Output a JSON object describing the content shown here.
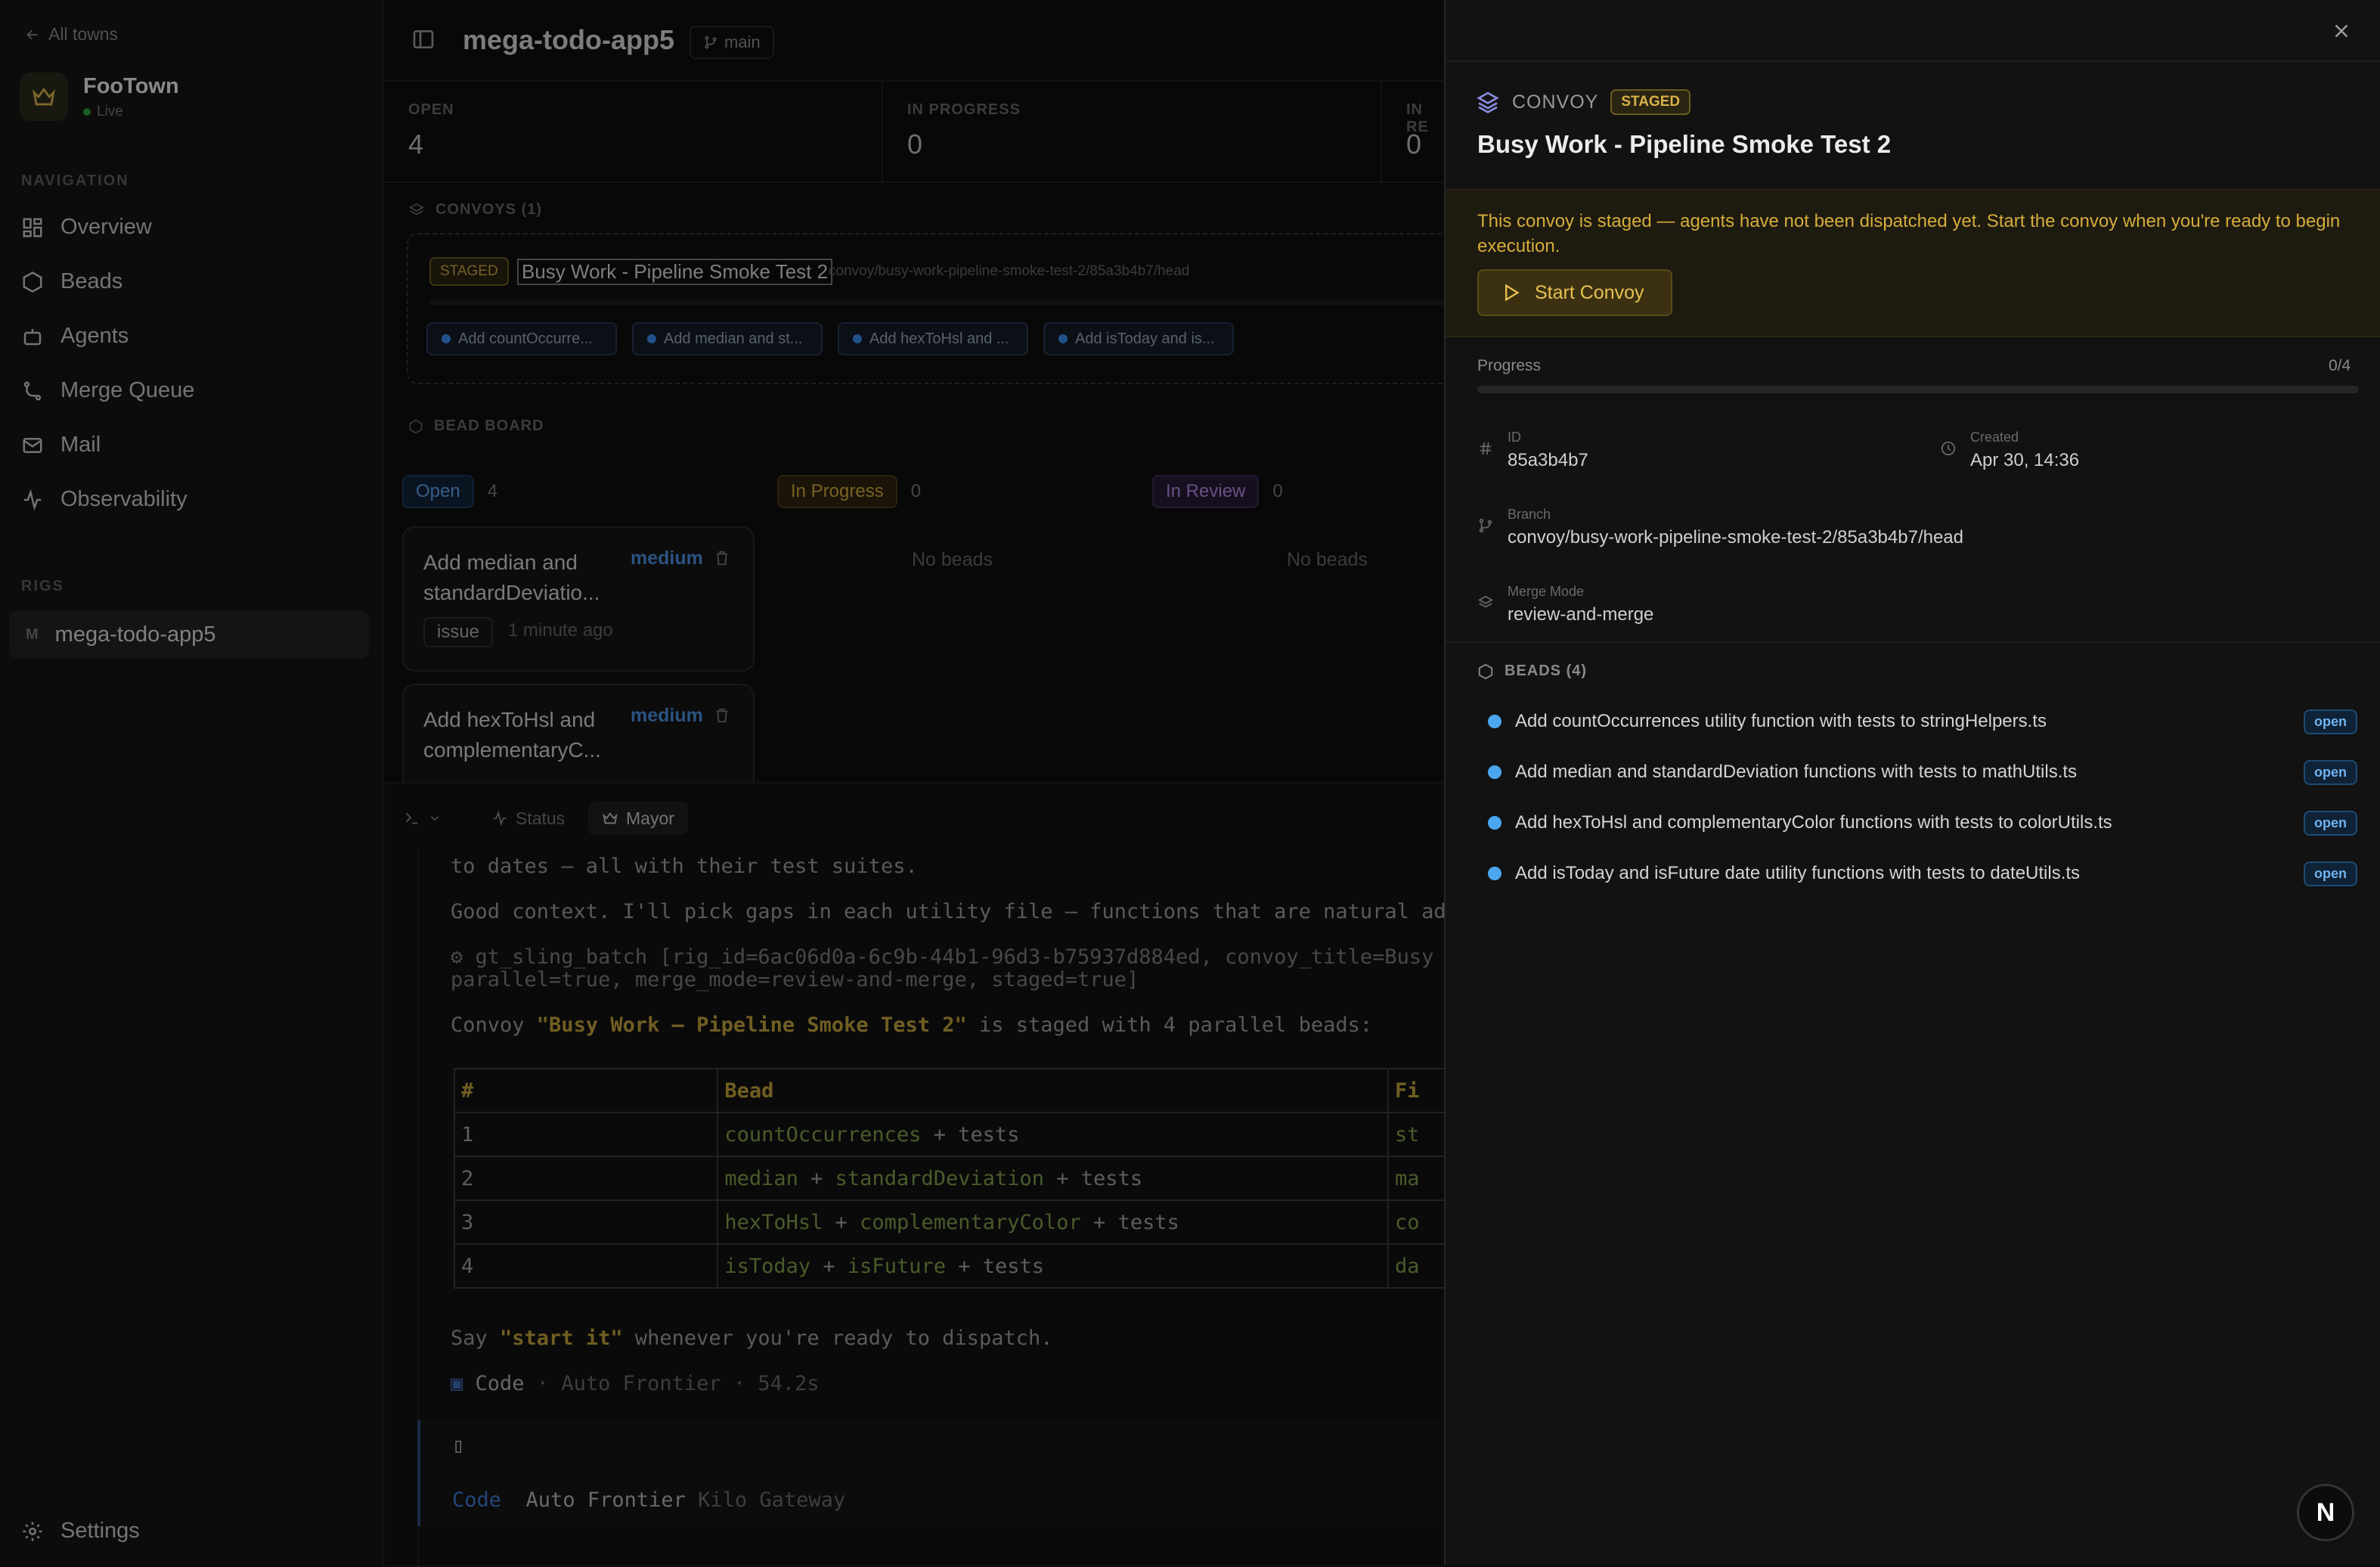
{
  "sidebar": {
    "back_label": "All towns",
    "town_name": "FooTown",
    "town_status": "Live",
    "nav_heading": "NAVIGATION",
    "nav_items": [
      {
        "label": "Overview",
        "icon": "grid-icon"
      },
      {
        "label": "Beads",
        "icon": "hexagon-icon"
      },
      {
        "label": "Agents",
        "icon": "bot-icon"
      },
      {
        "label": "Merge Queue",
        "icon": "git-merge-icon"
      },
      {
        "label": "Mail",
        "icon": "mail-icon"
      },
      {
        "label": "Observability",
        "icon": "activity-icon"
      }
    ],
    "rigs_heading": "RIGS",
    "rig": {
      "letter": "M",
      "label": "mega-todo-app5"
    },
    "settings_label": "Settings"
  },
  "main": {
    "title": "mega-todo-app5",
    "branch": "main",
    "stats": [
      {
        "label": "OPEN",
        "value": "4"
      },
      {
        "label": "IN PROGRESS",
        "value": "0"
      },
      {
        "label": "IN RE",
        "value": "0"
      }
    ],
    "convoys_heading": "CONVOYS (1)",
    "convoy": {
      "status": "STAGED",
      "title": "Busy Work - Pipeline Smoke Test 2",
      "branch": "convoy/busy-work-pipeline-smoke-test-2/85a3b4b7/head",
      "chips": [
        "Add countOccurre...",
        "Add median and st...",
        "Add hexToHsl and ...",
        "Add isToday and is..."
      ]
    },
    "bead_board_heading": "BEAD BOARD",
    "columns": [
      {
        "label": "Open",
        "count": "4"
      },
      {
        "label": "In Progress",
        "count": "0",
        "empty": "No beads"
      },
      {
        "label": "In Review",
        "count": "0",
        "empty": "No beads"
      }
    ],
    "bead_cards": [
      {
        "title": "Add median and standardDeviatio...",
        "priority": "medium",
        "tag": "issue",
        "time": "1 minute ago"
      },
      {
        "title": "Add hexToHsl and complementaryC...",
        "priority": "medium"
      }
    ]
  },
  "terminal": {
    "tabs": [
      {
        "label": "Status"
      },
      {
        "label": "Mayor"
      }
    ],
    "lines": {
      "l1": "to dates — all with their test suites.",
      "l2": "Good context. I'll pick gaps in each utility file — functions that are natural addit",
      "l3": "⚙ gt_sling_batch [rig_id=6ac06d0a-6c9b-44b1-96d3-b75937d884ed, convoy_title=Busy Wor",
      "l4": "parallel=true, merge_mode=review-and-merge, staged=true]",
      "l5_pre": "Convoy ",
      "l5_q": "\"Busy Work — Pipeline Smoke Test 2\"",
      "l5_post": " is staged with 4 parallel beads:",
      "say_pre": "Say ",
      "say_q": "\"start it\"",
      "say_post": " whenever you're ready to dispatch.",
      "code_meta_a": "Code",
      "code_meta_b": " · Auto Frontier · 54.2s",
      "input_cursor": "▯",
      "footer_a": "Code",
      "footer_b": "Auto Frontier",
      "footer_c": "Kilo Gateway"
    },
    "table": {
      "headers": [
        "#",
        "Bead",
        "Fi"
      ],
      "rows": [
        {
          "n": "1",
          "a": "countOccurrences",
          "b": "",
          "c": "st"
        },
        {
          "n": "2",
          "a": "median",
          "b": "standardDeviation",
          "c": "ma"
        },
        {
          "n": "3",
          "a": "hexToHsl",
          "b": "complementaryColor",
          "c": "co"
        },
        {
          "n": "4",
          "a": "isToday",
          "b": "isFuture",
          "c": "da"
        }
      ],
      "plus": " + ",
      "tests": "tests"
    }
  },
  "panel": {
    "kind": "CONVOY",
    "status": "STAGED",
    "title": "Busy Work - Pipeline Smoke Test 2",
    "banner": "This convoy is staged — agents have not been dispatched yet. Start the convoy when you're ready to begin execution.",
    "start_label": "Start Convoy",
    "progress_label": "Progress",
    "progress_count": "0/4",
    "progress_fraction": 0,
    "meta": {
      "id_label": "ID",
      "id_value": "85a3b4b7",
      "created_label": "Created",
      "created_value": "Apr 30, 14:36",
      "branch_label": "Branch",
      "branch_value": "convoy/busy-work-pipeline-smoke-test-2/85a3b4b7/head",
      "merge_label": "Merge Mode",
      "merge_value": "review-and-merge"
    },
    "beads_heading": "BEADS (4)",
    "beads": [
      {
        "label": "Add countOccurrences utility function with tests to stringHelpers.ts",
        "status": "open"
      },
      {
        "label": "Add median and standardDeviation functions with tests to mathUtils.ts",
        "status": "open"
      },
      {
        "label": "Add hexToHsl and complementaryColor functions with tests to colorUtils.ts",
        "status": "open"
      },
      {
        "label": "Add isToday and isFuture date utility functions with tests to dateUtils.ts",
        "status": "open"
      }
    ],
    "fab_label": "N"
  }
}
